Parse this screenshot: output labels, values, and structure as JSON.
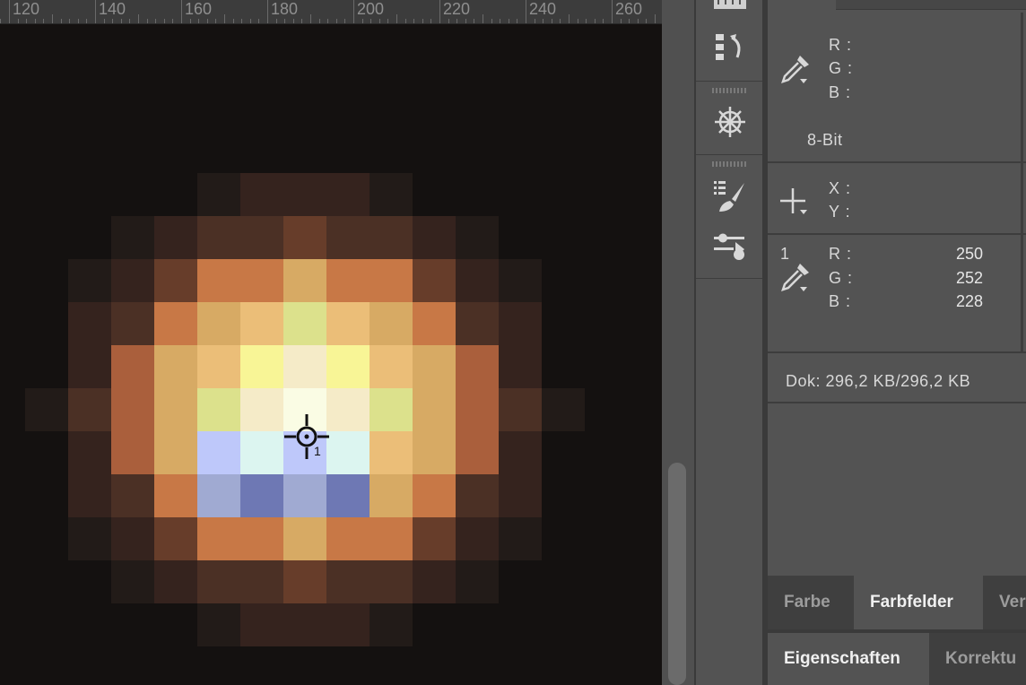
{
  "ruler": {
    "labels": [
      "120",
      "140",
      "160",
      "180",
      "200",
      "220",
      "240",
      "260"
    ]
  },
  "canvas": {
    "cursor_sample_number": "1"
  },
  "info_panel": {
    "color_readout": {
      "r_label": "R :",
      "g_label": "G :",
      "b_label": "B :",
      "icon": "eyedropper-icon"
    },
    "bit_depth": "8-Bit",
    "position_readout": {
      "x_label": "X :",
      "y_label": "Y :",
      "icon": "crosshair-plus-icon"
    },
    "sampler": {
      "number": "1",
      "r_label": "R :",
      "g_label": "G :",
      "b_label": "B :",
      "r_value": "250",
      "g_value": "252",
      "b_value": "228",
      "icon": "eyedropper-icon"
    },
    "doc_size": "Dok: 296,2 KB/296,2 KB"
  },
  "toolbar": {
    "icons": [
      "history-icon",
      "actions-icon",
      "brush-presets-icon",
      "adjustments-icon"
    ]
  },
  "tabs_top": {
    "items": [
      {
        "label": "Farbe"
      },
      {
        "label": "Farbfelder"
      },
      {
        "label": "Ver"
      }
    ],
    "active": "Farbfelder"
  },
  "tabs_bottom": {
    "items": [
      {
        "label": "Eigenschaften"
      },
      {
        "label": "Korrektu"
      }
    ],
    "active": "Eigenschaften"
  },
  "colors": {
    "panel_bg": "#535353",
    "canvas_bg": "#141110",
    "divider": "#3a3a3a"
  }
}
